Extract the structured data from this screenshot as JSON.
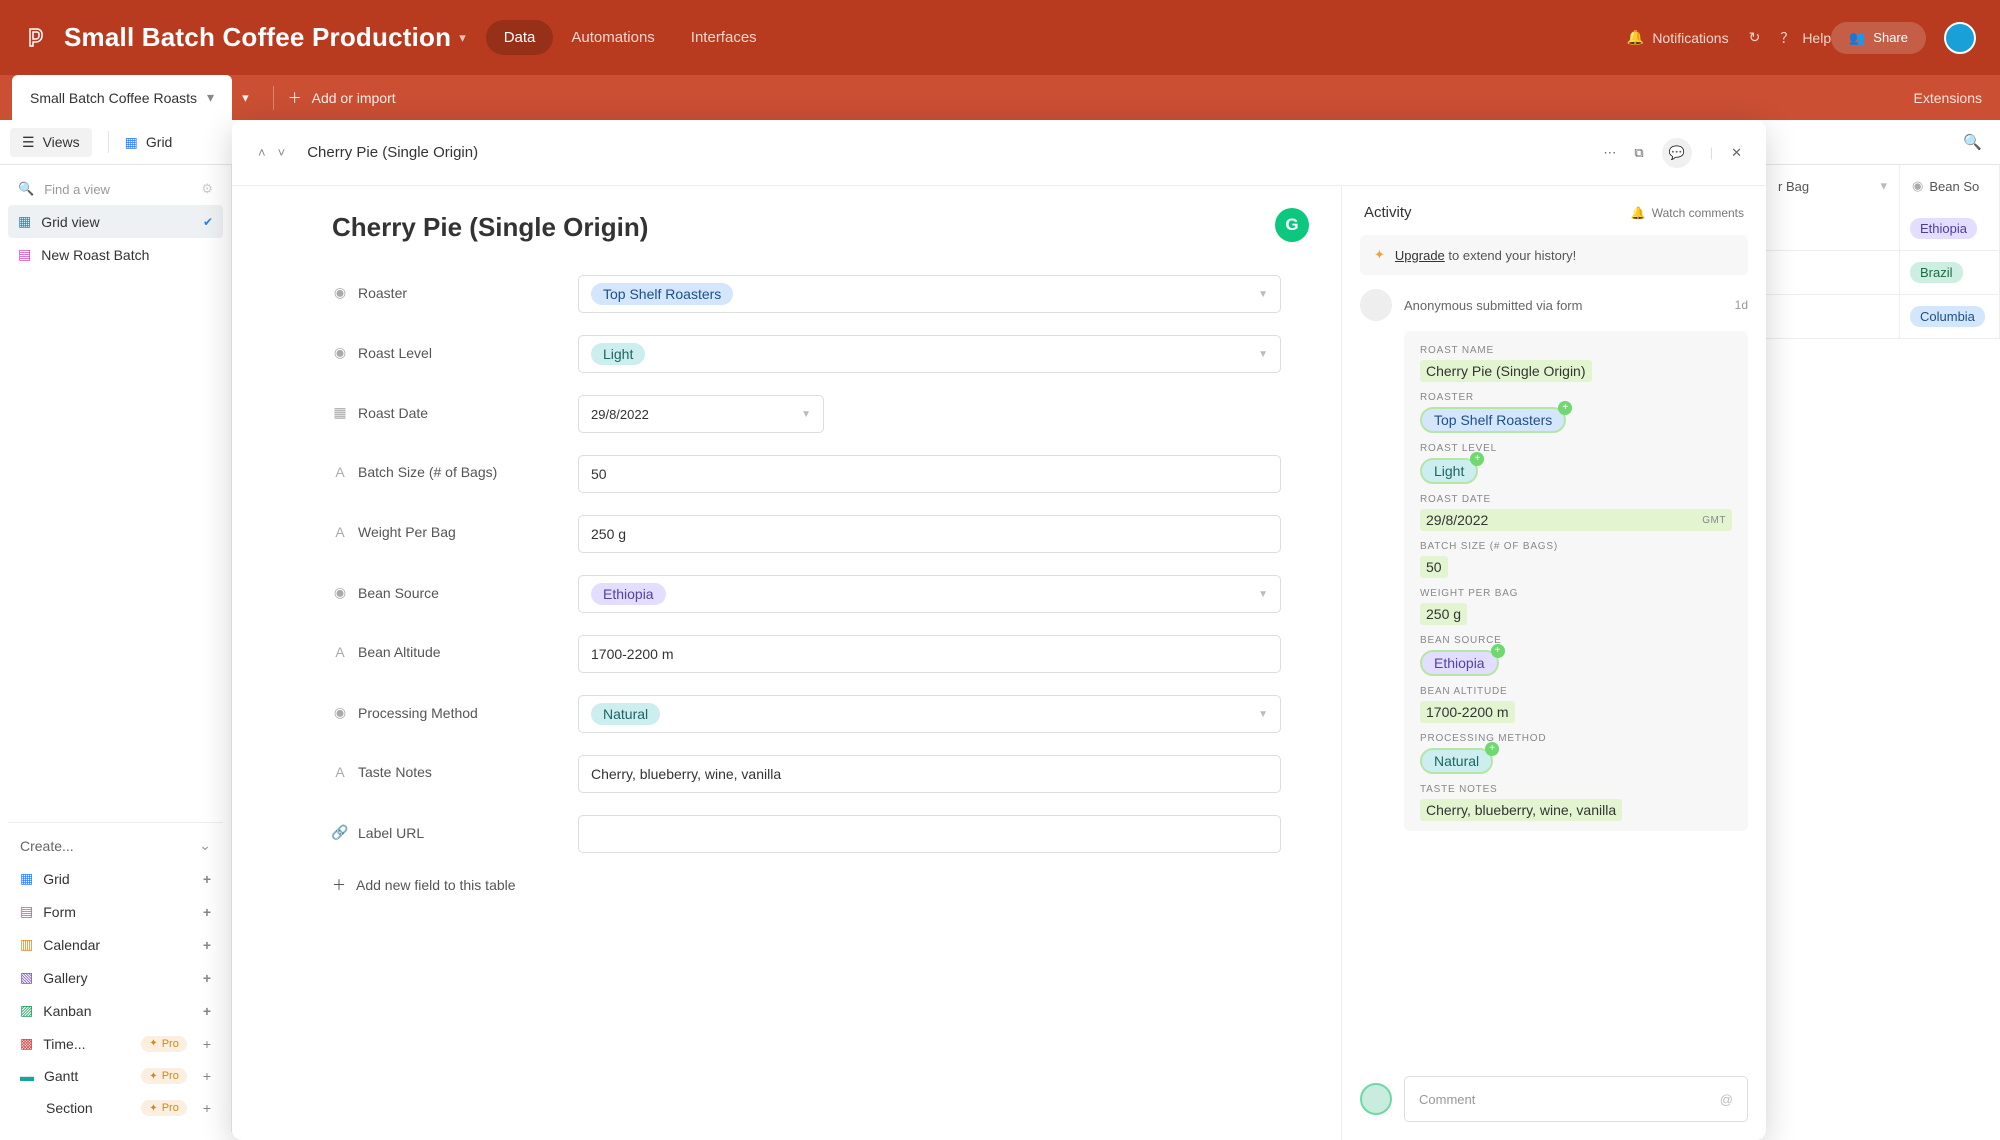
{
  "topbar": {
    "title": "Small Batch Coffee Production",
    "nav": {
      "data": "Data",
      "automations": "Automations",
      "interfaces": "Interfaces"
    },
    "notifications": "Notifications",
    "help": "Help",
    "share": "Share"
  },
  "tabs": {
    "active": "Small Batch Coffee Roasts",
    "add": "Add or import",
    "extensions": "Extensions"
  },
  "toolrow": {
    "views": "Views",
    "gridview": "Grid"
  },
  "sidebar": {
    "search_placeholder": "Find a view",
    "views": [
      {
        "label": "Grid view",
        "active": true
      },
      {
        "label": "New Roast Batch",
        "active": false
      }
    ],
    "create": "Create...",
    "types": [
      {
        "label": "Grid",
        "color": "#2d7ff9"
      },
      {
        "label": "Form",
        "color": "#d54ac2"
      },
      {
        "label": "Calendar",
        "color": "#e08a2a"
      },
      {
        "label": "Gallery",
        "color": "#7a4fd6"
      },
      {
        "label": "Kanban",
        "color": "#1a9e5a"
      },
      {
        "label": "Time...",
        "color": "#d64545",
        "pro": true
      },
      {
        "label": "Gantt",
        "color": "#1aa59a",
        "pro": true
      },
      {
        "label": "Section",
        "pro": true,
        "section": true
      }
    ],
    "pro": "Pro"
  },
  "bg_grid": {
    "col1": "r Bag",
    "col2": "Bean So",
    "rows": [
      {
        "source": "Ethiopia",
        "pill": "pill-eth"
      },
      {
        "source": "Brazil",
        "pill": "pill-bz"
      },
      {
        "source": "Columbia",
        "pill": "pill-co"
      }
    ]
  },
  "modal": {
    "breadcrumb": "Cherry Pie (Single Origin)",
    "title": "Cherry Pie (Single Origin)",
    "fields": {
      "roaster": {
        "label": "Roaster",
        "value": "Top Shelf Roasters"
      },
      "roast_level": {
        "label": "Roast Level",
        "value": "Light"
      },
      "roast_date": {
        "label": "Roast Date",
        "value": "29/8/2022"
      },
      "batch_size": {
        "label": "Batch Size (# of Bags)",
        "value": "50"
      },
      "weight": {
        "label": "Weight Per Bag",
        "value": "250 g"
      },
      "bean_source": {
        "label": "Bean Source",
        "value": "Ethiopia"
      },
      "bean_alt": {
        "label": "Bean Altitude",
        "value": "1700-2200 m"
      },
      "proc": {
        "label": "Processing Method",
        "value": "Natural"
      },
      "taste": {
        "label": "Taste Notes",
        "value": "Cherry, blueberry, wine, vanilla"
      },
      "url": {
        "label": "Label URL",
        "value": ""
      }
    },
    "add_field": "Add new field to this table"
  },
  "activity": {
    "title": "Activity",
    "watch": "Watch comments",
    "upgrade_link": "Upgrade",
    "upgrade_rest": " to extend your history!",
    "submitter": "Anonymous submitted via form",
    "when": "1d",
    "entries": {
      "roast_name": {
        "label": "ROAST NAME",
        "value": "Cherry Pie (Single Origin)"
      },
      "roaster": {
        "label": "ROASTER",
        "value": "Top Shelf Roasters"
      },
      "roast_level": {
        "label": "ROAST LEVEL",
        "value": "Light"
      },
      "roast_date": {
        "label": "ROAST DATE",
        "value": "29/8/2022",
        "gmt": "GMT"
      },
      "batch_size": {
        "label": "BATCH SIZE (# OF BAGS)",
        "value": "50"
      },
      "weight": {
        "label": "WEIGHT PER BAG",
        "value": "250 g"
      },
      "bean_source": {
        "label": "BEAN SOURCE",
        "value": "Ethiopia"
      },
      "bean_alt": {
        "label": "BEAN ALTITUDE",
        "value": "1700-2200 m"
      },
      "proc": {
        "label": "PROCESSING METHOD",
        "value": "Natural"
      },
      "taste": {
        "label": "TASTE NOTES",
        "value": "Cherry, blueberry, wine, vanilla"
      }
    },
    "comment_placeholder": "Comment"
  }
}
